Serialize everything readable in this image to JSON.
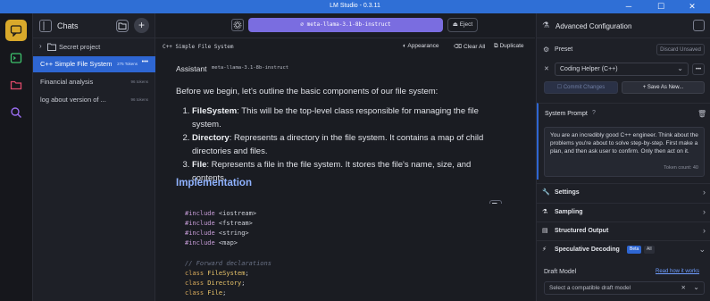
{
  "window": {
    "title": "LM Studio - 0.3.11",
    "minimize": "─",
    "maximize": "☐",
    "close": "✕"
  },
  "chats": {
    "title": "Chats",
    "new_label": "+",
    "folder": {
      "label": "Secret project"
    },
    "items": [
      {
        "title": "C++ Simple File System",
        "tokens": "275 Tokens",
        "menu": "•••"
      },
      {
        "title": "Financial analysis",
        "tokens": "96 tokens"
      },
      {
        "title": "log about version of ...",
        "tokens": "96 tokens"
      }
    ]
  },
  "main": {
    "model": "⌀  meta-llama-3.1-8b-instruct",
    "eject_label": "Eject",
    "file_name": "C++ Simple File System",
    "actions": {
      "appearance": "Appearance",
      "clear_all": "Clear All",
      "duplicate": "Duplicate"
    },
    "role": "Assistant",
    "role_model": "meta-llama-3.1-8b-instruct",
    "intro": "Before we begin, let's outline the basic components of our file system:",
    "list": [
      {
        "term": "FileSystem",
        "rest": ": This will be the top-level class responsible for managing the file system."
      },
      {
        "term": "Directory",
        "rest": ": Represents a directory in the file system. It contains a map of child directories and files."
      },
      {
        "term": "File",
        "rest": ": Represents a file in the file system. It stores the file's name, size, and contents."
      }
    ],
    "heading": "Implementation",
    "code": {
      "line1_kw": "#include",
      "line1_val": " <iostream>",
      "line2_kw": "#include",
      "line2_val": " <fstream>",
      "line3_kw": "#include",
      "line3_val": " <string>",
      "line4_kw": "#include",
      "line4_val": " <map>",
      "comment": "// Forward declarations",
      "decl1_kw": "class",
      "decl1_name": " FileSystem",
      "decl1_end": ";",
      "decl2_kw": "class",
      "decl2_name": " Directory",
      "decl2_end": ";",
      "decl3_kw": "class",
      "decl3_name": " File",
      "decl3_end": ";"
    }
  },
  "config": {
    "title": "Advanced Configuration",
    "preset_label": "Preset",
    "discard_label": "Discard Unsaved",
    "preset_value": "Coding Helper (C++)",
    "commit_label": "Commit Changes",
    "save_as_label": "+  Save As New...",
    "system_prompt_label": "System Prompt",
    "system_prompt": "You are an incredibly good C++ engineer. Think about the problems you're about to solve step-by-step. First make a plan, and then ask user to confirm. Only then act on it.",
    "token_count": "Token count: 40",
    "sections": [
      {
        "label": "Settings"
      },
      {
        "label": "Sampling"
      },
      {
        "label": "Structured Output"
      },
      {
        "label": "Speculative Decoding",
        "badge1": "Beta",
        "badge2": "All"
      }
    ],
    "draft_model_label": "Draft Model",
    "read_how_label": "Read how it works",
    "draft_placeholder": "Select a compatible draft model"
  },
  "colors": {
    "accent": "#2e66d2",
    "model_pill": "#7a6de0",
    "heading": "#8fb2ff",
    "active_activity": "#d9a92b"
  }
}
